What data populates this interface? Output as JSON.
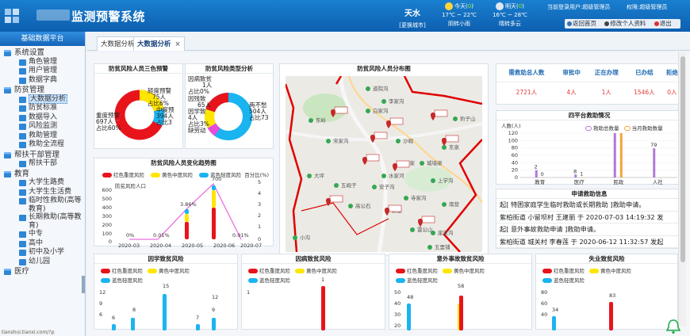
{
  "header": {
    "title": "监测预警系统",
    "city": "天水",
    "change_city": "[更换城市]",
    "today": {
      "label": "今天(",
      "hl": "0",
      "close": ")",
      "temp": "17℃ ~ 22℃",
      "cond": "阴转小雨"
    },
    "tomorrow": {
      "label": "明天(",
      "hl": "0",
      "close": ")",
      "temp": "16℃ ~ 28℃",
      "cond": "晴转多云"
    },
    "user": "当前登录用户:超级管理员",
    "role": "权限:超级管理员",
    "links": {
      "home": "返回首页",
      "edit": "修改个人资料",
      "logout": "退出"
    }
  },
  "sidebar": {
    "title": "基础数据平台",
    "items": [
      {
        "type": "grp",
        "label": "系统设置"
      },
      {
        "type": "sub",
        "label": "角色管理"
      },
      {
        "type": "sub",
        "label": "用户管理"
      },
      {
        "type": "sub",
        "label": "数据字典"
      },
      {
        "type": "grp",
        "label": "防贫管理"
      },
      {
        "type": "sub",
        "label": "大数据分析",
        "active": true
      },
      {
        "type": "sub",
        "label": "防贫标准"
      },
      {
        "type": "sub",
        "label": "数据导入"
      },
      {
        "type": "sub",
        "label": "风险监测"
      },
      {
        "type": "sub",
        "label": "救助管理"
      },
      {
        "type": "sub",
        "label": "救助全流程"
      },
      {
        "type": "grp",
        "label": "帮扶干部管理"
      },
      {
        "type": "sub",
        "label": "帮扶干部"
      },
      {
        "type": "grp",
        "label": "教育"
      },
      {
        "type": "sub",
        "label": "大学生路费"
      },
      {
        "type": "sub",
        "label": "大学生生活费"
      },
      {
        "type": "sub",
        "label": "临时性救助(高等教育)",
        "ml": true
      },
      {
        "type": "sub",
        "label": "长期救助(高等教育)",
        "ml": true
      },
      {
        "type": "sub",
        "label": "中专"
      },
      {
        "type": "sub",
        "label": "高中"
      },
      {
        "type": "sub",
        "label": "初中及小学"
      },
      {
        "type": "sub",
        "label": "幼儿园"
      },
      {
        "type": "grp",
        "label": "医疗"
      }
    ],
    "url": "tianshui.tianxi.com/?p"
  },
  "tabs": [
    {
      "label": "大数据分析"
    },
    {
      "label": "大数据分析",
      "close": "×"
    }
  ],
  "colors": {
    "red": "#e8141c",
    "yellow": "#ffe600",
    "blue": "#1ab4f0",
    "pink": "#e84bd7",
    "purple": "#b07ad6",
    "orange": "#f3a23b"
  },
  "panels": {
    "three_level": {
      "title": "防贫风险人员三色预警",
      "labels": [
        {
          "lines": [
            "轻度预警",
            "75人",
            "占比6%"
          ]
        },
        {
          "lines": [
            "中度预",
            "394人",
            "占比3"
          ]
        },
        {
          "lines": [
            "重度预警",
            "697人",
            "占比60%"
          ]
        }
      ]
    },
    "type_analysis": {
      "title": "防贫风险类型分析",
      "labels": [
        {
          "lines": [
            "因病致贫",
            "1人",
            "占比0%"
          ]
        },
        {
          "lines": [
            "因残致",
            "65人",
            "占比5%"
          ]
        },
        {
          "lines": [
            "因学致",
            "4人",
            "占比3%"
          ]
        },
        {
          "lines": [
            "缺劳动",
            "125人",
            "占比18%"
          ]
        },
        {
          "lines": [
            "两不愁",
            "504人",
            "占比73"
          ]
        }
      ]
    },
    "trend": {
      "title": "防贫风险人员变化趋势图",
      "legend": [
        "红色重度风险",
        "黄色中度风险",
        "蓝色轻度风险",
        "百分比(%)"
      ],
      "series_label": "防贫风险人口"
    },
    "map": {
      "title": "防贫风险人员分布图",
      "places": [
        "道院沟",
        "李家沟",
        "白家沟",
        "豹子山",
        "城墙梁",
        "安子沟",
        "上学沟",
        "吴家",
        "大坪",
        "五岘子",
        "高公石",
        "新堡",
        "沙岘",
        "南营",
        "寺家沟",
        "宋家沟",
        "水家河",
        "雷公山",
        "崖家沟",
        "小沟",
        "五里铺",
        "东岭",
        "东泉"
      ]
    },
    "stats": {
      "headers": [
        "需救助总人数",
        "审批中",
        "正在办理",
        "已办结",
        "拒绝"
      ],
      "values": [
        "2721人",
        "4人",
        "1人",
        "1546人",
        "0人"
      ]
    },
    "rescue": {
      "title": "四平台救助情况",
      "legend": [
        "救助总数量",
        "当月救助数量"
      ],
      "y_label": "人数(人)",
      "chart_data": {
        "type": "bar",
        "categories": [
          "教育",
          "医疗",
          "民政",
          "人社"
        ],
        "series": [
          {
            "name": "救助总数量",
            "values": [
              20,
              8,
              120,
              79
            ]
          },
          {
            "name": "当月救助数量",
            "values": [
              0,
              1,
              120,
              0
            ]
          }
        ],
        "ylim": [
          0,
          120
        ],
        "yticks": [
          0,
          20,
          40,
          60,
          80,
          100,
          120
        ],
        "data_labels": [
          {
            "series": 0,
            "cat": 0,
            "text": "2"
          },
          {
            "series": 1,
            "cat": 0,
            "text": "0"
          },
          {
            "series": 0,
            "cat": 1,
            "text": "8"
          },
          {
            "series": 1,
            "cat": 1,
            "text": "1"
          },
          {
            "series": 0,
            "cat": 3,
            "text": "79"
          }
        ]
      }
    },
    "requests": {
      "title": "申请救助信息",
      "lines": [
        "起[ 特困家庭学生临时救助或长期救助 ]救助申请。",
        "紫柏街道 小留坝村 王建丽 于 2020-07-03 14:19:32 发",
        "起[ 意外事故救助申请 ]救助申请。",
        "紫柏街道 城关村 李春莲 于 2020-06-12 11:32:57 发起"
      ]
    },
    "bottom": [
      {
        "title": "因学致贫风险",
        "legend": [
          "红色重度风险",
          "黄色中度风险",
          "蓝色轻度风险"
        ],
        "yticks": [
          "12",
          "9",
          "6"
        ],
        "labels": [
          "15",
          "8",
          "6",
          "7",
          "9",
          "12"
        ]
      },
      {
        "title": "因病致贫风险",
        "legend": [
          "红色重度风险",
          "黄色中度风险",
          "蓝色轻度风险"
        ],
        "yticks": [
          "1"
        ],
        "labels": [
          "1"
        ]
      },
      {
        "title": "意外事故致贫风险",
        "legend": [
          "红色重度风险",
          "黄色中度风险",
          "蓝色轻度风险"
        ],
        "yticks": [
          "50",
          "40",
          "30",
          "20"
        ],
        "labels": [
          "48",
          "58"
        ]
      },
      {
        "title": "失业致贫风险",
        "legend": [
          "红色重度风险",
          "黄色中度风险",
          "蓝色轻度风险"
        ],
        "yticks": [
          "80",
          "60",
          "40"
        ],
        "labels": [
          "83",
          "34"
        ]
      }
    ]
  }
}
